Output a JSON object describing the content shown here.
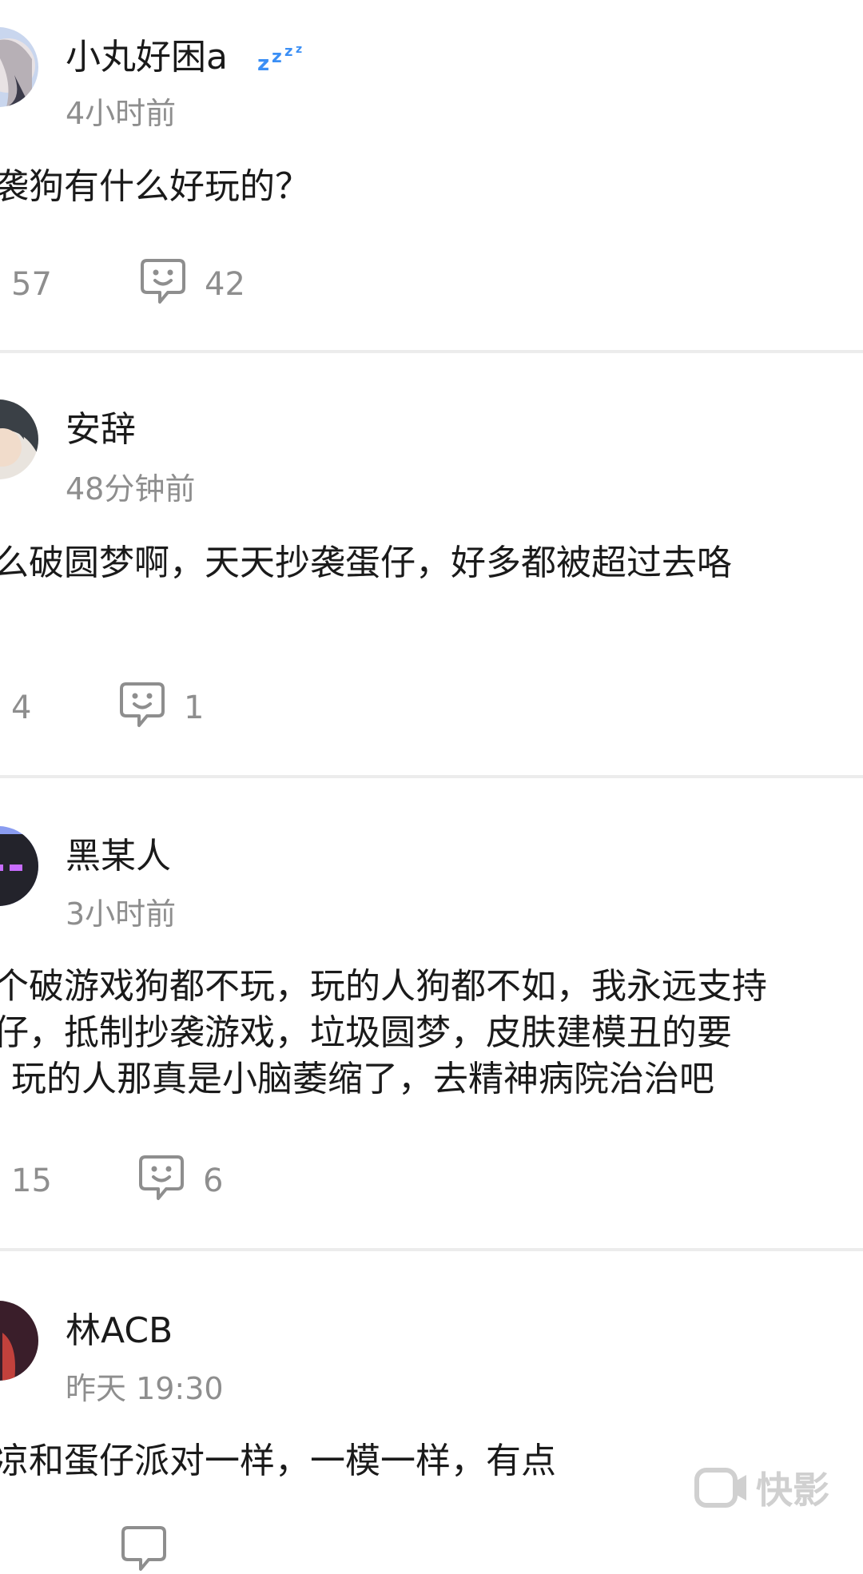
{
  "posts": [
    {
      "username": "小丸好困a",
      "time": "4小时前",
      "content": [
        "袭狗有什么好玩的？"
      ],
      "likes": "57",
      "comments": "42"
    },
    {
      "username": "安辞",
      "time": "48分钟前",
      "content": [
        "么破圆梦啊，天天抄袭蛋仔，好多都被超过去咯"
      ],
      "likes": "4",
      "comments": "1"
    },
    {
      "username": "黑某人",
      "time": "3小时前",
      "content": [
        "个破游戏狗都不玩，玩的人狗都不如，我永远支持",
        "仔，抵制抄袭游戏，垃圾圆梦，皮肤建模丑的要",
        "玩的人那真是小脑萎缩了，去精神病院治治吧"
      ],
      "likes": "15",
      "comments": "6"
    },
    {
      "username": "林ACB",
      "time": "昨天 19:30",
      "content": [
        "凉和蛋仔派对一样，一模一样，有点"
      ],
      "likes": "",
      "comments": ""
    }
  ],
  "watermark": "快影",
  "colors": {
    "text": "#1a1a1a",
    "muted": "#8e8e8e",
    "divider": "#ececec",
    "zzz": "#3b8ff5"
  },
  "icons": [
    "comment-smiley-icon",
    "zzz-sleep-icon",
    "kuaiying-logo-icon"
  ]
}
